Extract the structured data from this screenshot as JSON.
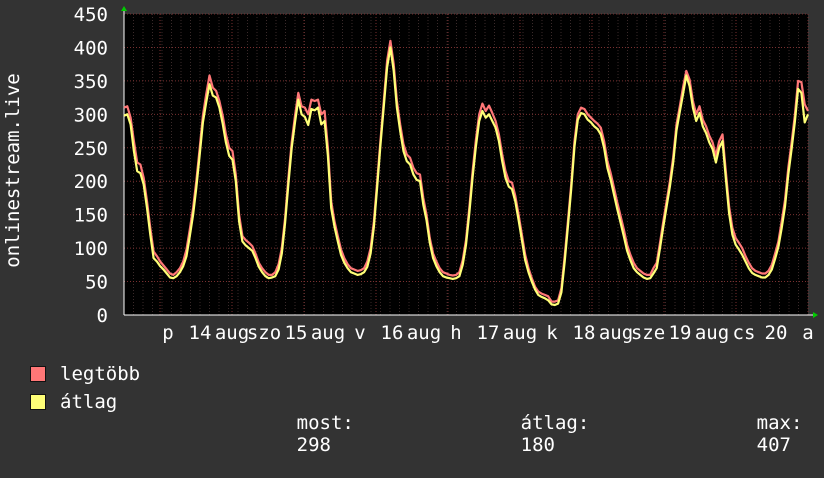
{
  "chart_data": {
    "type": "line",
    "ylabel": "onlinestream.live",
    "ylim": [
      0,
      450
    ],
    "yticks": [
      0,
      50,
      100,
      150,
      200,
      250,
      300,
      350,
      400,
      450
    ],
    "x_tick_labels": [
      "p",
      "14",
      "aug",
      "szo",
      "15",
      "aug",
      "v",
      "16",
      "aug",
      "h",
      "17",
      "aug",
      "k",
      "18",
      "aug",
      "sze",
      "19",
      "aug",
      "cs",
      "20",
      "a"
    ],
    "grid": true,
    "background": "#000000",
    "series": [
      {
        "name": "legtöbb",
        "color": "#ff7777",
        "values": [
          310,
          312,
          295,
          260,
          228,
          225,
          205,
          170,
          130,
          95,
          88,
          80,
          74,
          68,
          62,
          60,
          64,
          70,
          80,
          98,
          128,
          160,
          200,
          248,
          298,
          330,
          358,
          340,
          335,
          320,
          298,
          270,
          250,
          245,
          210,
          150,
          118,
          112,
          108,
          103,
          92,
          78,
          70,
          64,
          60,
          60,
          64,
          76,
          100,
          145,
          205,
          258,
          298,
          332,
          312,
          310,
          300,
          322,
          320,
          322,
          300,
          305,
          250,
          170,
          140,
          118,
          98,
          85,
          76,
          70,
          68,
          66,
          67,
          70,
          80,
          100,
          140,
          200,
          262,
          320,
          380,
          410,
          375,
          320,
          285,
          255,
          240,
          235,
          220,
          212,
          210,
          175,
          150,
          115,
          92,
          80,
          70,
          64,
          62,
          60,
          59,
          60,
          64,
          82,
          112,
          160,
          215,
          262,
          300,
          316,
          305,
          313,
          302,
          290,
          270,
          240,
          215,
          200,
          198,
          178,
          150,
          120,
          90,
          70,
          55,
          42,
          35,
          32,
          30,
          28,
          20,
          20,
          22,
          40,
          88,
          140,
          195,
          260,
          300,
          310,
          308,
          300,
          295,
          290,
          286,
          280,
          260,
          230,
          212,
          190,
          168,
          148,
          128,
          105,
          90,
          78,
          70,
          66,
          62,
          60,
          60,
          70,
          78,
          108,
          140,
          170,
          200,
          236,
          285,
          312,
          340,
          365,
          352,
          320,
          300,
          312,
          292,
          282,
          268,
          258,
          238,
          260,
          270,
          215,
          162,
          130,
          115,
          108,
          100,
          88,
          78,
          70,
          66,
          64,
          62,
          62,
          66,
          75,
          92,
          110,
          140,
          172,
          220,
          258,
          298,
          350,
          348,
          315,
          305
        ],
        "mark_name": "series-line-legtobb"
      },
      {
        "name": "átlag",
        "color": "#ffff77",
        "values": [
          298,
          300,
          285,
          245,
          215,
          212,
          195,
          160,
          120,
          85,
          80,
          73,
          68,
          62,
          56,
          55,
          58,
          64,
          73,
          88,
          118,
          150,
          190,
          238,
          288,
          318,
          345,
          328,
          325,
          310,
          286,
          258,
          238,
          232,
          200,
          140,
          110,
          104,
          100,
          96,
          85,
          72,
          64,
          58,
          55,
          56,
          58,
          68,
          92,
          138,
          196,
          250,
          288,
          322,
          300,
          296,
          284,
          308,
          306,
          310,
          285,
          290,
          238,
          160,
          132,
          110,
          90,
          78,
          70,
          64,
          62,
          60,
          61,
          64,
          72,
          92,
          132,
          192,
          255,
          312,
          370,
          400,
          365,
          310,
          275,
          245,
          230,
          225,
          210,
          202,
          200,
          165,
          142,
          108,
          85,
          73,
          64,
          58,
          56,
          55,
          54,
          55,
          58,
          75,
          105,
          152,
          206,
          252,
          290,
          305,
          295,
          300,
          290,
          280,
          260,
          230,
          205,
          192,
          188,
          170,
          142,
          112,
          82,
          64,
          50,
          38,
          30,
          27,
          25,
          22,
          16,
          15,
          17,
          34,
          80,
          132,
          188,
          252,
          292,
          302,
          300,
          292,
          288,
          282,
          278,
          270,
          250,
          220,
          202,
          180,
          158,
          138,
          118,
          96,
          82,
          70,
          64,
          60,
          56,
          54,
          55,
          62,
          70,
          100,
          132,
          162,
          192,
          228,
          276,
          304,
          330,
          358,
          342,
          310,
          290,
          302,
          282,
          272,
          258,
          248,
          228,
          250,
          260,
          205,
          152,
          120,
          105,
          98,
          90,
          80,
          70,
          63,
          60,
          58,
          56,
          56,
          60,
          68,
          84,
          102,
          130,
          162,
          210,
          248,
          288,
          338,
          332,
          288,
          300
        ],
        "mark_name": "series-line-atlag"
      }
    ],
    "legend": {
      "items": [
        {
          "label": "legtöbb",
          "color": "#ff7777"
        },
        {
          "label": "átlag",
          "color": "#ffff77"
        }
      ],
      "placement": "bottom-left",
      "most_label": "most:",
      "most_value": "298",
      "atlag_label": "átlag:",
      "atlag_value": "180",
      "max_label": "max:",
      "max_value": "407"
    }
  }
}
